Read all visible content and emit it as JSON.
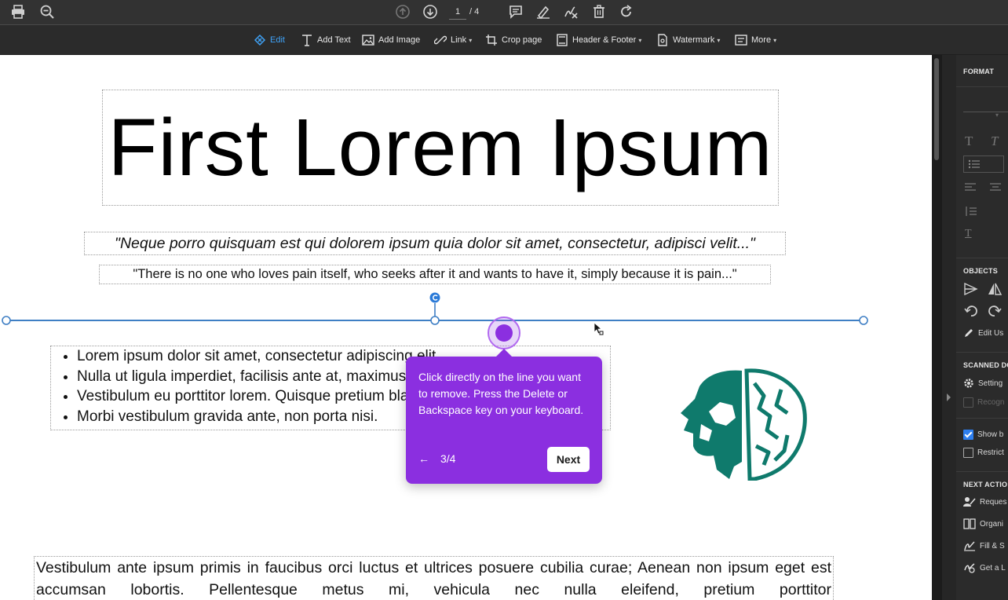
{
  "topbar": {
    "page_current": "1",
    "page_total": "/ 4"
  },
  "edit_toolbar": {
    "edit": "Edit",
    "add_text": "Add Text",
    "add_image": "Add Image",
    "link": "Link",
    "crop_page": "Crop page",
    "header_footer": "Header & Footer",
    "watermark": "Watermark",
    "more": "More"
  },
  "document": {
    "title": "First Lorem Ipsum",
    "quote1": "\"Neque porro quisquam est qui dolorem ipsum quia dolor sit amet, consectetur, adipisci velit...\"",
    "quote2": "\"There is no one who loves pain itself, who seeks after it and wants to have it, simply because it is pain...\"",
    "bullets": [
      "Lorem ipsum dolor sit amet, consectetur adipiscing elit.",
      "Nulla ut ligula imperdiet, facilisis ante at, maximus erat.",
      "Vestibulum eu porttitor lorem. Quisque pretium blandit purus at.",
      "Morbi vestibulum gravida ante, non porta nisi."
    ],
    "paragraph": "Vestibulum ante ipsum primis in faucibus orci luctus et ultrices posuere cubilia curae; Aenean non ipsum eget est accumsan lobortis. Pellentesque metus mi, vehicula nec nulla eleifend, pretium porttitor"
  },
  "tooltip": {
    "text": "Click directly on the line you want to remove. Press the Delete or Backspace key on your keyboard.",
    "back": "←",
    "counter": "3/4",
    "next": "Next"
  },
  "right_panel": {
    "format_header": "FORMAT",
    "objects_header": "OBJECTS",
    "edit_using": "Edit Us",
    "scanned_header": "SCANNED DO",
    "settings": "Setting",
    "recognize": "Recogn",
    "show_b": "Show b",
    "restrict": "Restrict",
    "next_actions_header": "NEXT ACTIO",
    "request": "Reques",
    "organize": "Organi",
    "fill_sign": "Fill & S",
    "get_link": "Get a L"
  },
  "colors": {
    "accent": "#8b2fe0",
    "line": "#3f7fc4",
    "logo": "#0f7a6c",
    "active_tool": "#3fa2f7"
  }
}
